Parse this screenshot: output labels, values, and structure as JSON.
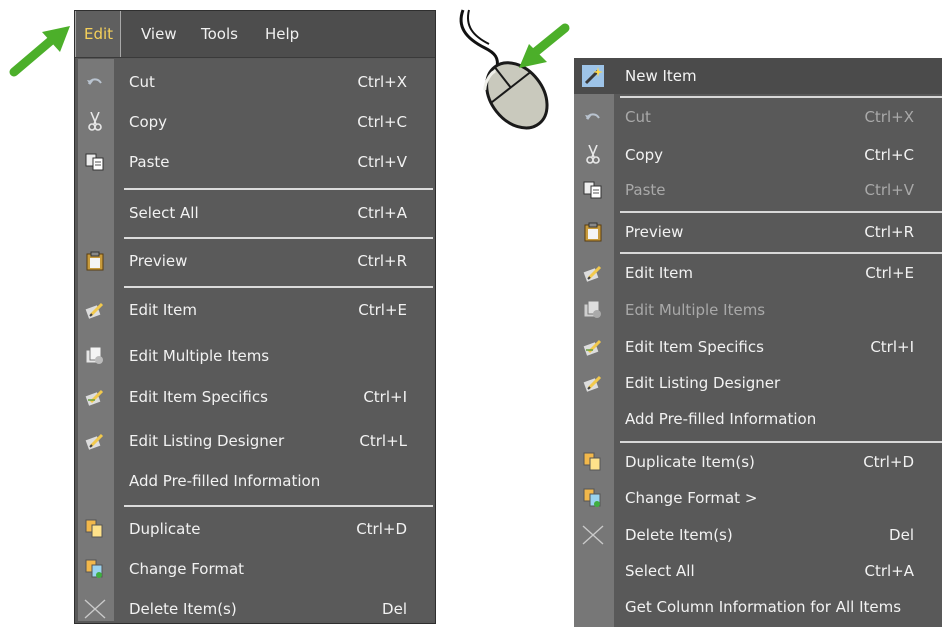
{
  "left_menu": {
    "menubar": {
      "edit": "Edit",
      "view": "View",
      "tools": "Tools",
      "help": "Help"
    },
    "items": [
      {
        "label": "Cut",
        "shortcut": "Ctrl+X",
        "icon": "undo-icon"
      },
      {
        "label": "Copy",
        "shortcut": "Ctrl+C",
        "icon": "scissors-icon"
      },
      {
        "label": "Paste",
        "shortcut": "Ctrl+V",
        "icon": "copy-pages-icon"
      },
      {
        "label": "Select All",
        "shortcut": "Ctrl+A",
        "icon": ""
      },
      {
        "label": "Preview",
        "shortcut": "Ctrl+R",
        "icon": "clipboard-icon"
      },
      {
        "label": "Edit Item",
        "shortcut": "Ctrl+E",
        "icon": "edit-pencil-icon"
      },
      {
        "label": "Edit Multiple Items",
        "shortcut": "",
        "icon": "edit-multiple-icon"
      },
      {
        "label": "Edit Item Specifics",
        "shortcut": "Ctrl+I",
        "icon": "edit-specifics-icon"
      },
      {
        "label": "Edit Listing Designer",
        "shortcut": "Ctrl+L",
        "icon": "edit-pencil-icon"
      },
      {
        "label": "Add Pre-filled Information",
        "shortcut": "",
        "icon": ""
      },
      {
        "label": "Duplicate",
        "shortcut": "Ctrl+D",
        "icon": "duplicate-icon"
      },
      {
        "label": "Change Format",
        "shortcut": "",
        "icon": "change-format-icon"
      },
      {
        "label": "Delete Item(s)",
        "shortcut": "Del",
        "icon": "delete-x-icon"
      }
    ]
  },
  "right_menu": {
    "items": [
      {
        "label": "New Item",
        "shortcut": "",
        "icon": "magic-wand-icon"
      },
      {
        "label": "Cut",
        "shortcut": "Ctrl+X",
        "icon": "undo-icon"
      },
      {
        "label": "Copy",
        "shortcut": "Ctrl+C",
        "icon": "scissors-icon"
      },
      {
        "label": "Paste",
        "shortcut": "Ctrl+V",
        "icon": "copy-pages-icon"
      },
      {
        "label": "Preview",
        "shortcut": "Ctrl+R",
        "icon": "clipboard-icon"
      },
      {
        "label": "Edit Item",
        "shortcut": "Ctrl+E",
        "icon": "edit-pencil-icon"
      },
      {
        "label": "Edit Multiple Items",
        "shortcut": "",
        "icon": "edit-multiple-icon"
      },
      {
        "label": "Edit Item Specifics",
        "shortcut": "Ctrl+I",
        "icon": "edit-specifics-icon"
      },
      {
        "label": "Edit Listing Designer",
        "shortcut": "",
        "icon": "edit-pencil-icon"
      },
      {
        "label": "Add Pre-filled Information",
        "shortcut": "",
        "icon": ""
      },
      {
        "label": "Duplicate Item(s)",
        "shortcut": "Ctrl+D",
        "icon": "duplicate-icon"
      },
      {
        "label": "Change Format >",
        "shortcut": "",
        "icon": "change-format-icon"
      },
      {
        "label": "Delete Item(s)",
        "shortcut": "Del",
        "icon": "delete-x-icon"
      },
      {
        "label": "Select All",
        "shortcut": "Ctrl+A",
        "icon": ""
      },
      {
        "label": "Get Column Information for All Items",
        "shortcut": "",
        "icon": ""
      }
    ]
  },
  "colors": {
    "menu_bg": "#5a5a5a",
    "icon_strip": "#787878",
    "active_menu_text": "#f6d15a",
    "arrow_green": "#4caf2a",
    "disabled_text": "#a9a9a9"
  }
}
